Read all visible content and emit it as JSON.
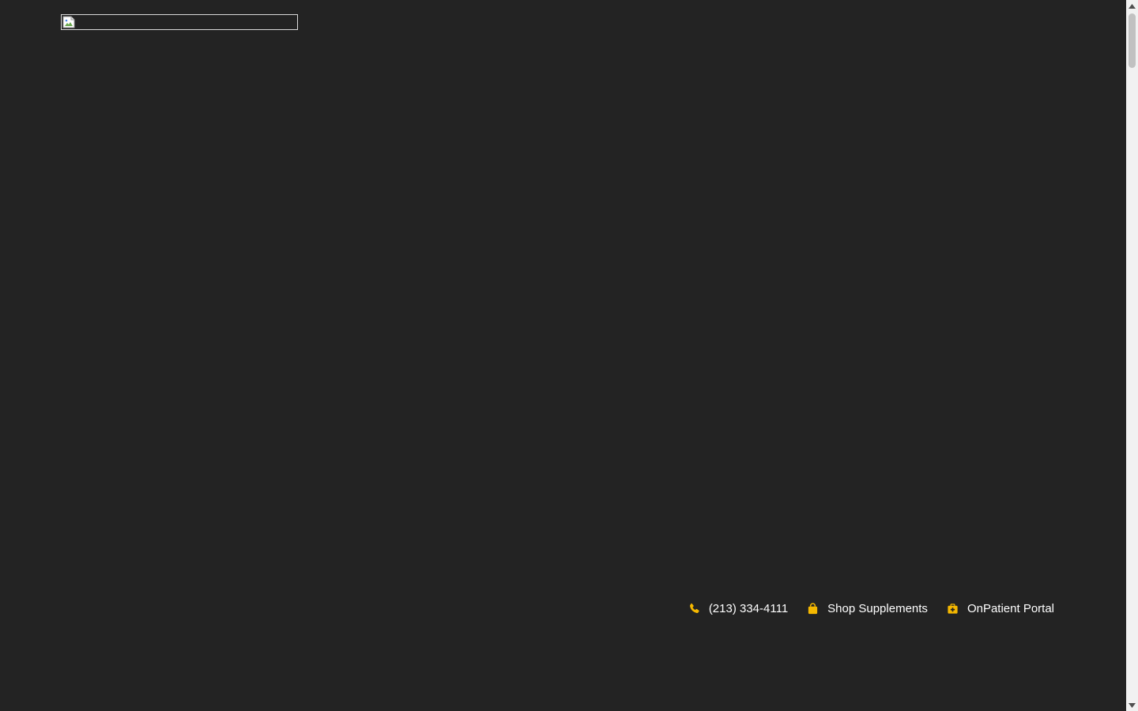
{
  "header": {
    "logo_alt": ""
  },
  "contact_bar": {
    "phone": {
      "label": "(213) 334-4111",
      "icon": "phone-icon"
    },
    "shop": {
      "label": "Shop Supplements",
      "icon": "shopping-bag-icon"
    },
    "portal": {
      "label": "OnPatient Portal",
      "icon": "medical-kit-icon"
    }
  },
  "colors": {
    "background": "#232323",
    "accent": "#f5b800",
    "text": "#ffffff"
  }
}
